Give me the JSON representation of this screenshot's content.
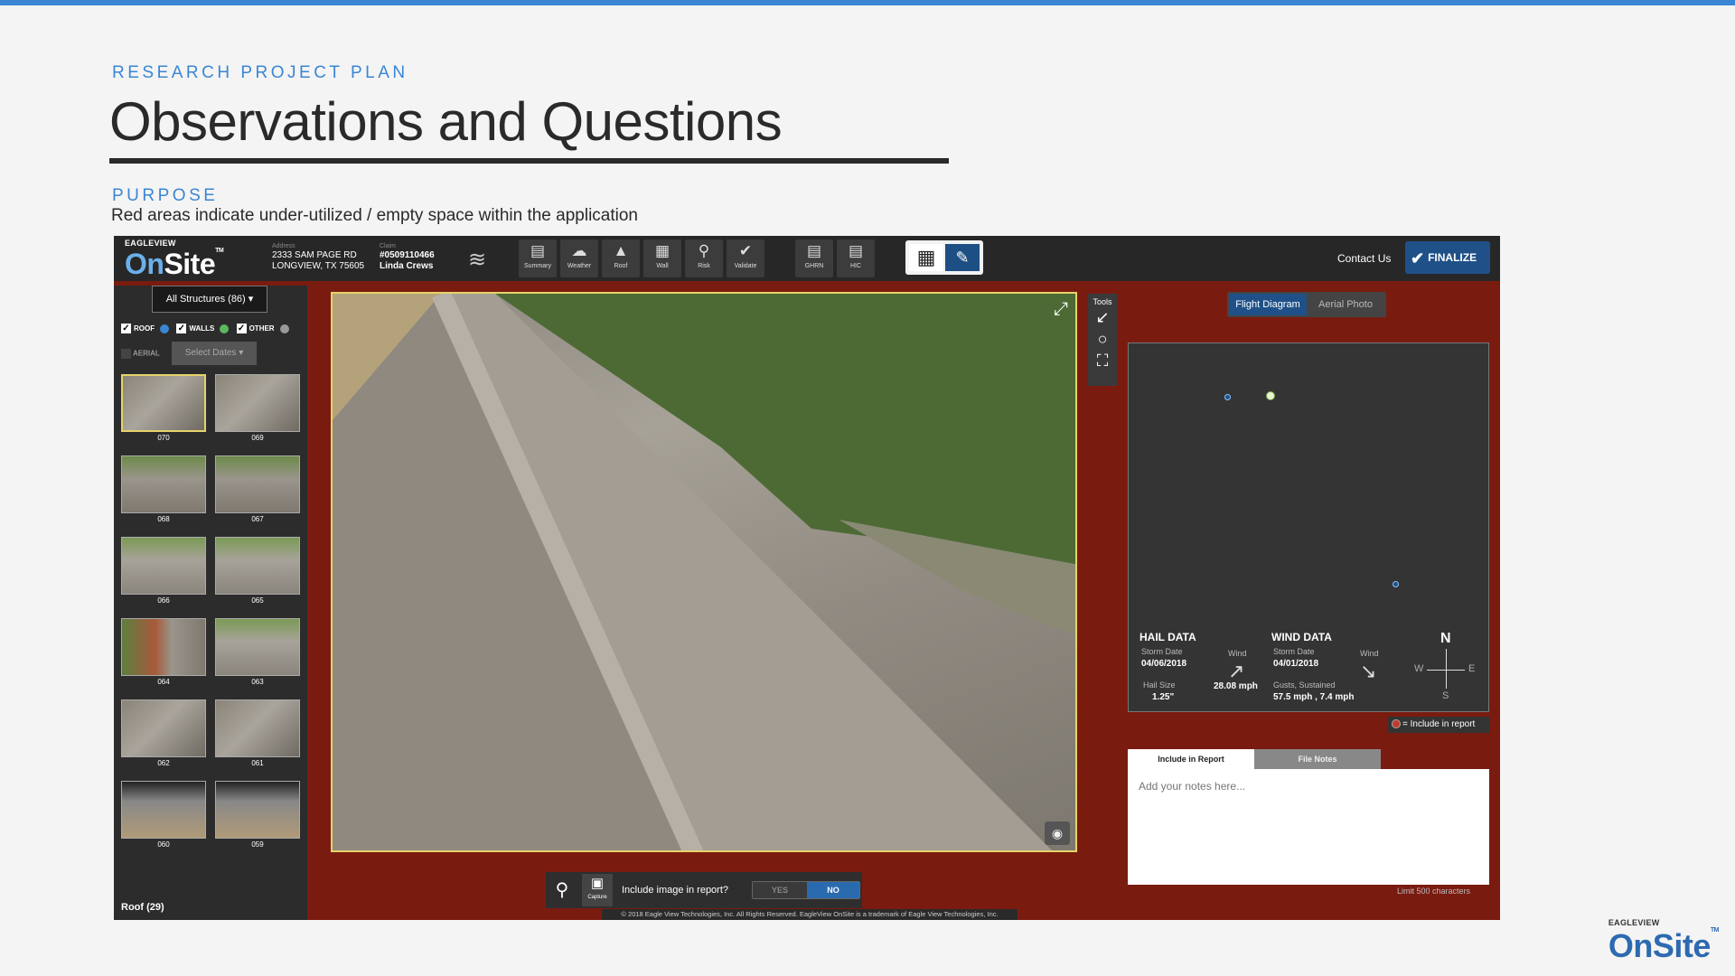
{
  "slide": {
    "kicker": "RESEARCH PROJECT PLAN",
    "title": "Observations and Questions",
    "purpose_label": "PURPOSE",
    "purpose_text": "Red areas indicate under-utilized / empty space within the application"
  },
  "brand": {
    "eagleview": "EAGLEVIEW",
    "onsite_on": "On",
    "onsite_site": "Site",
    "tm": "TM"
  },
  "header": {
    "address_caption": "Address",
    "address_line1": "2333 SAM PAGE RD",
    "address_line2": "LONGVIEW, TX 75605",
    "claim_caption": "Claim",
    "claim_number": "#0509110466",
    "claim_name": "Linda Crews",
    "tools": [
      {
        "label": "Summary",
        "icon": "summary-icon"
      },
      {
        "label": "Weather",
        "icon": "weather-icon"
      },
      {
        "label": "Roof",
        "icon": "roof-icon"
      },
      {
        "label": "Wall",
        "icon": "wall-icon"
      },
      {
        "label": "Risk",
        "icon": "risk-icon"
      },
      {
        "label": "Validate",
        "icon": "validate-icon"
      },
      {
        "label": "GHRN",
        "icon": "clipboard-icon"
      },
      {
        "label": "HIC",
        "icon": "clipboard-icon"
      }
    ],
    "contact": "Contact Us",
    "finalize": "FINALIZE"
  },
  "left": {
    "structures": "All Structures (86)",
    "filters": [
      {
        "label": "ROOF",
        "color": "#3a86d4"
      },
      {
        "label": "WALLS",
        "color": "#5cb85c"
      },
      {
        "label": "OTHER",
        "color": "#999999"
      }
    ],
    "aerial": "AERIAL",
    "select_dates": "Select Dates",
    "thumbs": [
      "070",
      "069",
      "068",
      "067",
      "066",
      "065",
      "064",
      "063",
      "062",
      "061",
      "060",
      "059"
    ],
    "roof_header": "Roof (29)"
  },
  "tools_panel": {
    "label": "Tools"
  },
  "right": {
    "tab_flight": "Flight Diagram",
    "tab_aerial": "Aerial Photo",
    "hail": {
      "title": "HAIL DATA",
      "storm_date_label": "Storm Date",
      "storm_date": "04/06/2018",
      "wind_label": "Wind",
      "wind_value": "28.08 mph",
      "hail_size_label": "Hail Size",
      "hail_size": "1.25\""
    },
    "wind": {
      "title": "WIND DATA",
      "storm_date_label": "Storm Date",
      "storm_date": "04/01/2018",
      "wind_label": "Wind",
      "gusts_label": "Gusts, Sustained",
      "gusts_value": "57.5 mph , 7.4 mph"
    },
    "compass": {
      "n": "N",
      "w": "W",
      "e": "E",
      "s": "S"
    },
    "legend": "= Include in report",
    "notes_tab1": "Include in Report",
    "notes_tab2": "File Notes",
    "notes_placeholder": "Add your notes here...",
    "limit": "Limit 500 characters"
  },
  "bottom": {
    "capture": "Capture",
    "question": "Include image in report?",
    "yes": "YES",
    "no": "NO"
  },
  "copyright": "© 2018 Eagle View Technologies, Inc. All Rights Reserved. EagleView OnSite is a trademark of Eagle View Technologies, Inc."
}
